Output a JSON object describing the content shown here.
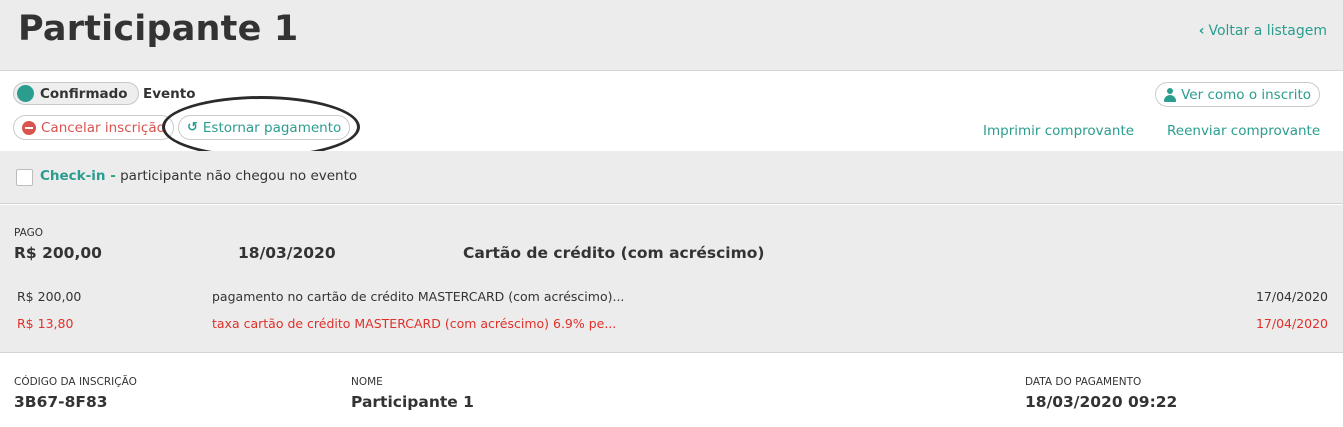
{
  "header": {
    "title": "Participante 1",
    "back_link": "Voltar a listagem"
  },
  "status": {
    "label": "Confirmado",
    "event_label": "Evento"
  },
  "actions": {
    "cancel": "Cancelar inscrição",
    "refund": "Estornar pagamento",
    "view_as_registrant": "Ver como o inscrito",
    "print_receipt": "Imprimir comprovante",
    "resend_receipt": "Reenviar comprovante"
  },
  "checkin": {
    "title": "Check-in -",
    "text": "participante não chegou no evento",
    "checked": false
  },
  "payment": {
    "status": "PAGO",
    "amount": "R$ 200,00",
    "date": "18/03/2020",
    "method": "Cartão de crédito (com acréscimo)",
    "transactions": [
      {
        "amount": "R$ 200,00",
        "description": "pagamento no cartão de crédito MASTERCARD (com acréscimo)...",
        "date": "17/04/2020"
      },
      {
        "amount": "R$ 13,80",
        "description": "taxa cartão de crédito MASTERCARD (com acréscimo) 6.9% pe...",
        "date": "17/04/2020"
      }
    ]
  },
  "info": {
    "code_label": "CÓDIGO DA INSCRIÇÃO",
    "code_value": "3B67-8F83",
    "name_label": "NOME",
    "name_value": "Participante 1",
    "paydate_label": "DATA DO PAGAMENTO",
    "paydate_value": "18/03/2020 09:22"
  },
  "colors": {
    "accent": "#2a9d8f",
    "danger": "#d9534f",
    "fee_text": "#e0302a"
  },
  "icons": {
    "back": "chevron-left-icon",
    "status": "status-dot-icon",
    "cancel": "no-entry-icon",
    "refund": "undo-icon",
    "view": "user-icon"
  }
}
